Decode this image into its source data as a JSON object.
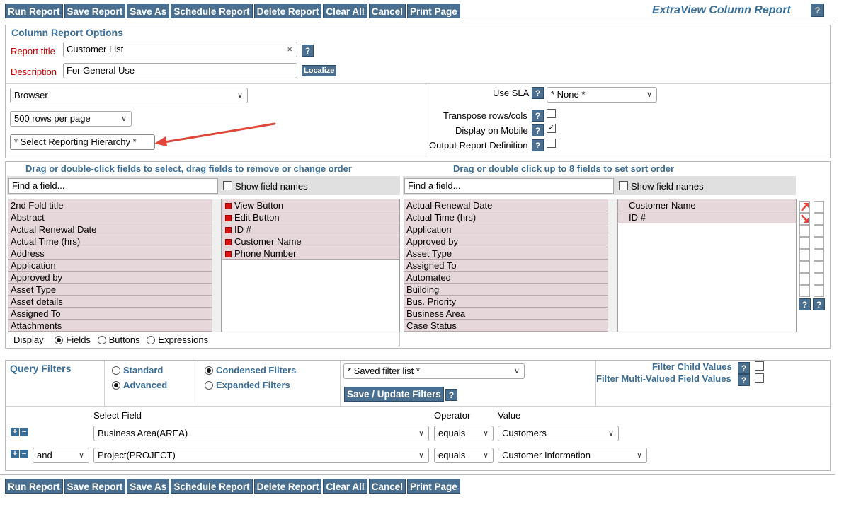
{
  "toolbar": {
    "buttons": [
      "Run Report",
      "Save Report",
      "Save As",
      "Schedule Report",
      "Delete Report",
      "Clear All",
      "Cancel",
      "Print Page"
    ],
    "title": "ExtraView Column Report",
    "help": "?"
  },
  "options": {
    "heading": "Column Report Options",
    "report_title_label": "Report title",
    "report_title_value": "Customer List",
    "clear_glyph": "×",
    "description_label": "Description",
    "description_value": "For General Use",
    "localize": "Localize",
    "output_select": "Browser",
    "rows_select": "500 rows per page",
    "hierarchy_select": "* Select Reporting Hierarchy *",
    "use_sla_label": "Use SLA",
    "sla_select": "* None *",
    "transpose_label": "Transpose rows/cols",
    "mobile_label": "Display on Mobile",
    "output_def_label": "Output Report Definition",
    "transpose_checked": false,
    "mobile_checked": true,
    "output_def_checked": false
  },
  "fields": {
    "left_heading": "Drag or double-click fields to select, drag fields to remove or change order",
    "right_heading": "Drag or double click up to 8 fields to set sort order",
    "find_placeholder": "Find a field...",
    "show_field_names": "Show field names",
    "available": [
      "2nd Fold title",
      "Abstract",
      "Actual Renewal Date",
      "Actual Time (hrs)",
      "Address",
      "Application",
      "Approved by",
      "Asset Type",
      "Asset details",
      "Assigned To",
      "Attachments"
    ],
    "selected": [
      "View Button",
      "Edit Button",
      "ID #",
      "Customer Name",
      "Phone Number"
    ],
    "display_label": "Display",
    "display_options": [
      "Fields",
      "Buttons",
      "Expressions"
    ],
    "sort_available": [
      "Actual Renewal Date",
      "Actual Time (hrs)",
      "Application",
      "Approved by",
      "Asset Type",
      "Assigned To",
      "Automated",
      "Building",
      "Bus. Priority",
      "Business Area",
      "Case Status"
    ],
    "sort_selected": [
      "Customer Name",
      "ID #"
    ]
  },
  "filters": {
    "heading": "Query Filters",
    "standard": "Standard",
    "advanced": "Advanced",
    "condensed": "Condensed Filters",
    "expanded": "Expanded Filters",
    "saved_filter": "* Saved filter list *",
    "save_update": "Save / Update Filters",
    "filter_child": "Filter Child Values",
    "filter_multi": "Filter Multi-Valued Field Values",
    "col_select_field": "Select Field",
    "col_operator": "Operator",
    "col_value": "Value",
    "rows": [
      {
        "conj": "",
        "field": "Business Area(AREA)",
        "operator": "equals",
        "value": "Customers"
      },
      {
        "conj": "and",
        "field": "Project(PROJECT)",
        "operator": "equals",
        "value": "Customer Information"
      }
    ]
  },
  "colors": {
    "button": "#4a6f8f",
    "heading": "#3a6d96",
    "required": "#c00000",
    "list_item": "#e6d7da",
    "arrow": "#e0463a"
  }
}
